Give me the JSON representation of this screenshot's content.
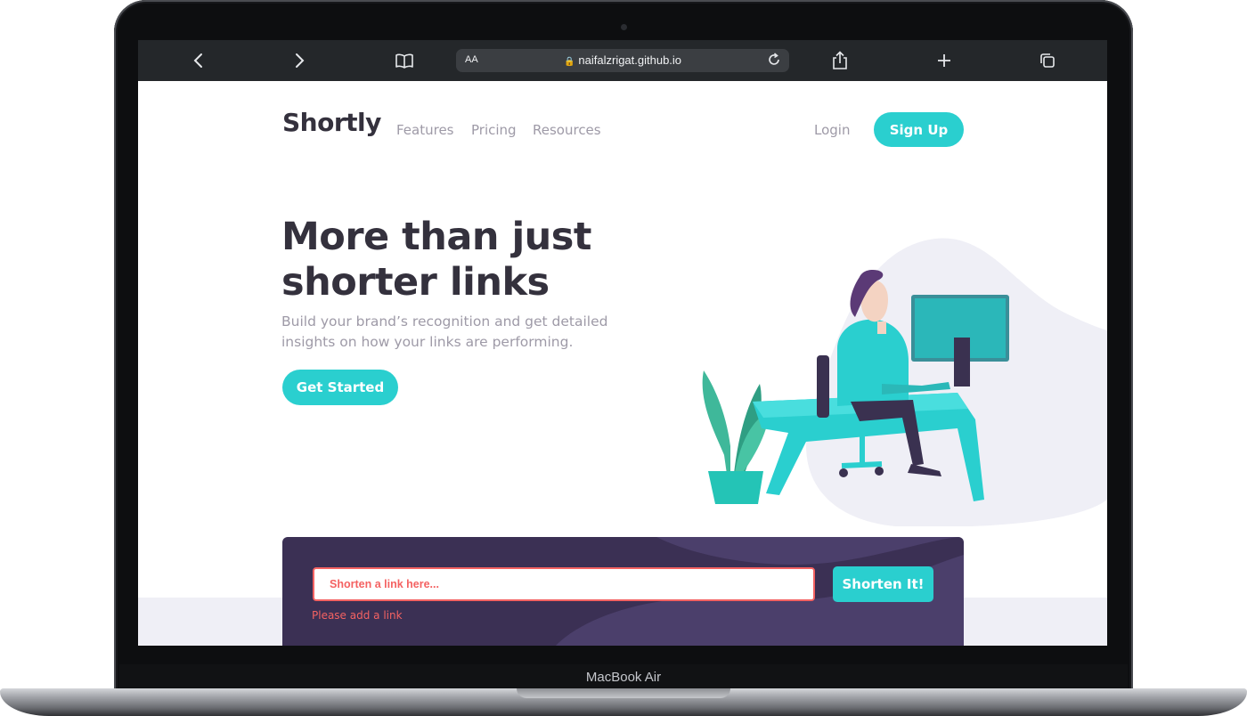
{
  "device": {
    "label": "MacBook Air"
  },
  "browser": {
    "url": "naifalzrigat.github.io",
    "text_size_label": "AA",
    "icons": [
      "chevron-left-icon",
      "chevron-right-icon",
      "book-icon",
      "lock-icon",
      "reload-icon",
      "share-icon",
      "plus-icon",
      "tabs-icon"
    ]
  },
  "header": {
    "logo": "Shortly",
    "nav": [
      "Features",
      "Pricing",
      "Resources"
    ],
    "login": "Login",
    "signup": "Sign Up"
  },
  "hero": {
    "title": "More than just shorter links",
    "subtitle": "Build your brand’s recognition and get detailed insights on how your links are performing.",
    "cta": "Get Started"
  },
  "shorten": {
    "placeholder": "Shorten a link here...",
    "button": "Shorten It!",
    "error": "Please add a link"
  },
  "colors": {
    "primary": "#2acfcf",
    "dark_violet": "#3b3054",
    "red": "#f46262",
    "text_dark": "#34313d",
    "text_gray": "#9e9aa7",
    "browser_bar": "#24272a"
  }
}
